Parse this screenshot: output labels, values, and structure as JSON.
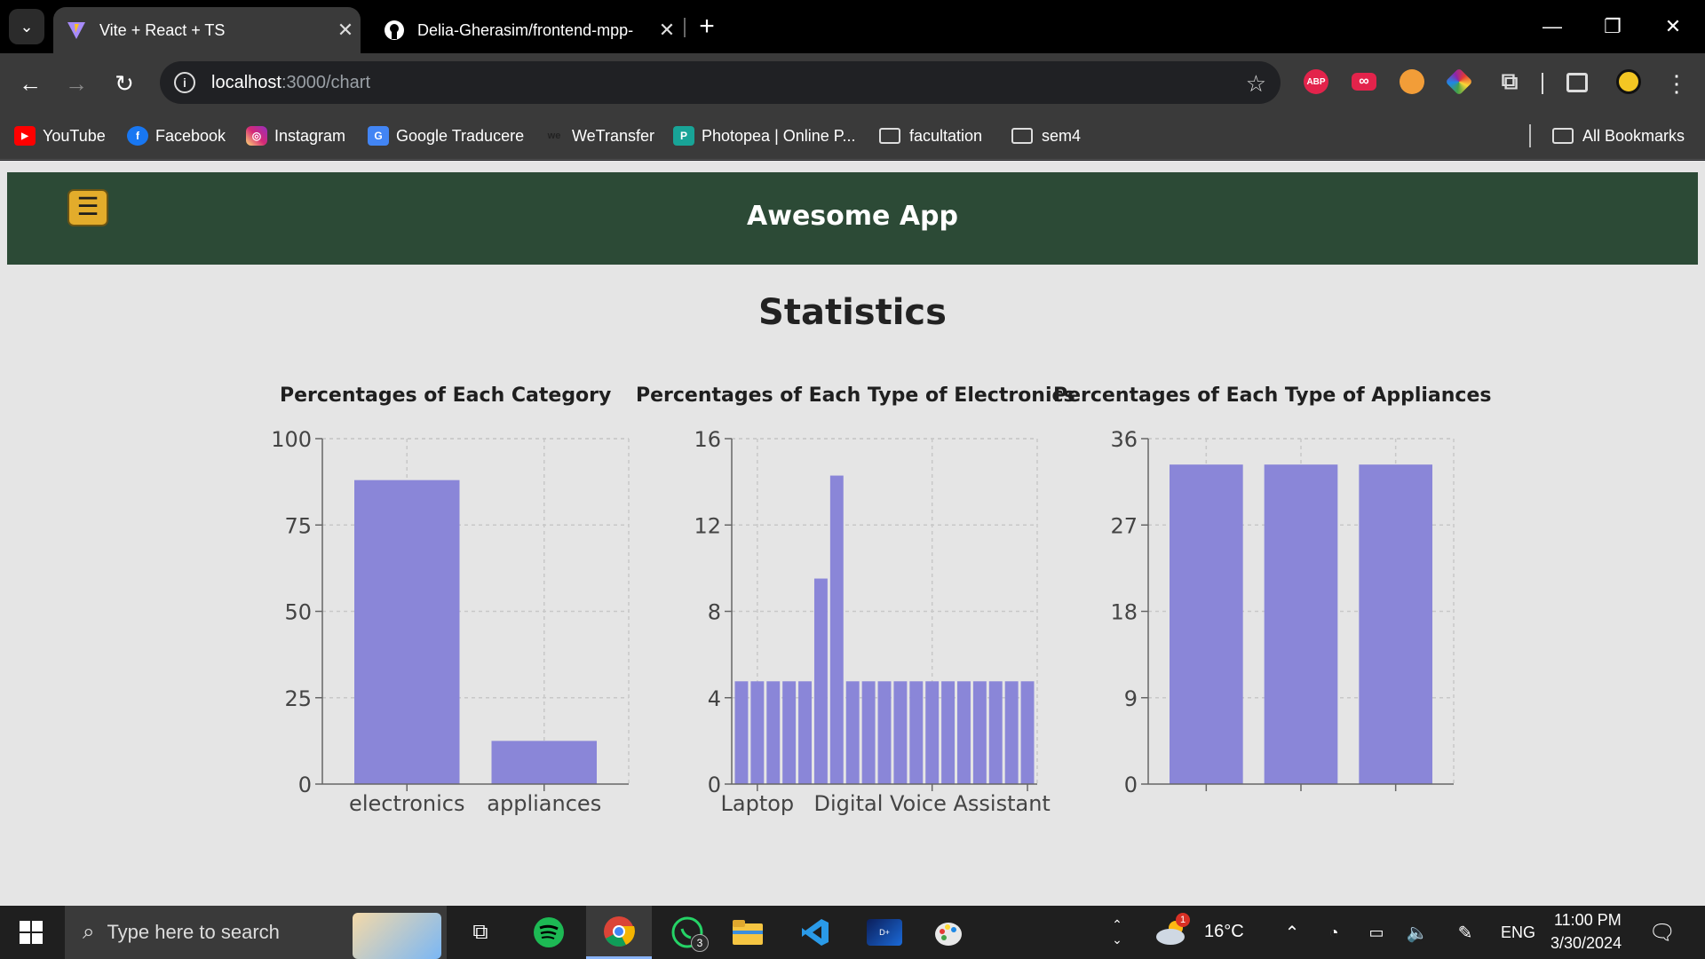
{
  "browser": {
    "tabs": [
      {
        "title": "Vite + React + TS",
        "active": true,
        "icon": "vite-icon"
      },
      {
        "title": "Delia-Gherasim/frontend-mpp-",
        "active": false,
        "icon": "github-icon"
      }
    ],
    "url_host": "localhost",
    "url_path": ":3000/chart",
    "bookmarks": [
      {
        "label": "YouTube",
        "icon": "youtube-icon",
        "color": "#ff0000"
      },
      {
        "label": "Facebook",
        "icon": "facebook-icon",
        "color": "#1877f2"
      },
      {
        "label": "Instagram",
        "icon": "instagram-icon",
        "color": "#d62976"
      },
      {
        "label": "Google Traducere",
        "icon": "google-translate-icon",
        "color": "#4285f4"
      },
      {
        "label": "WeTransfer",
        "icon": "wetransfer-icon",
        "color": "#333333"
      },
      {
        "label": "Photopea | Online P...",
        "icon": "photopea-icon",
        "color": "#18a497"
      },
      {
        "label": "facultation",
        "icon": "folder-icon"
      },
      {
        "label": "sem4",
        "icon": "folder-icon"
      }
    ],
    "all_bookmarks": "All Bookmarks",
    "extensions": [
      {
        "name": "adblock-plus-icon",
        "label": "ABP",
        "color": "#e3234b"
      },
      {
        "name": "infinity-extension-icon",
        "label": "∞",
        "color": "#e3234b"
      },
      {
        "name": "monkey-extension-icon",
        "label": "🐵",
        "color": "#f29d38"
      },
      {
        "name": "color-picker-icon",
        "label": "◆",
        "color": "#7b3fe4"
      }
    ]
  },
  "app": {
    "title": "Awesome App",
    "menu_icon": "hamburger-icon",
    "page_title": "Statistics",
    "accent_color": "#2c4a36",
    "button_color": "#e3ac2b",
    "bar_color": "#8a86d8"
  },
  "chart_data": [
    {
      "type": "bar",
      "title": "Percentages of Each Category",
      "categories": [
        "electronics",
        "appliances"
      ],
      "values": [
        88,
        12.5
      ],
      "ylim": [
        0,
        100
      ],
      "yticks": [
        "0",
        "25",
        "50",
        "75",
        "100"
      ],
      "xticklabels": [
        "electronics",
        "appliances"
      ],
      "grid": true
    },
    {
      "type": "bar",
      "title": "Percentages of Each Type of Electronics",
      "categories": [
        "Laptop",
        "",
        "",
        "",
        "",
        "",
        "",
        "Digital Voice Assistant",
        "",
        "",
        "",
        "",
        "",
        "",
        "",
        "",
        "",
        "",
        ""
      ],
      "values": [
        4.76,
        4.76,
        4.76,
        4.76,
        4.76,
        9.52,
        14.29,
        4.76,
        4.76,
        4.76,
        4.76,
        4.76,
        4.76,
        4.76,
        4.76,
        4.76,
        4.76,
        4.76,
        4.76
      ],
      "ylim": [
        0,
        16
      ],
      "yticks": [
        "0",
        "4",
        "8",
        "12",
        "16"
      ],
      "xticklabels": [
        "Laptop",
        "Digital Voice Assistant"
      ],
      "grid": true
    },
    {
      "type": "bar",
      "title": "Percentages of Each Type of Appliances",
      "categories": [
        "",
        "",
        ""
      ],
      "values": [
        33.3,
        33.3,
        33.3
      ],
      "ylim": [
        0,
        36
      ],
      "yticks": [
        "0",
        "9",
        "18",
        "27",
        "36"
      ],
      "xticklabels": [],
      "grid": true
    }
  ],
  "taskbar": {
    "search_placeholder": "Type here to search",
    "weather": "16°C",
    "language": "ENG",
    "time": "11:00 PM",
    "date": "3/30/2024",
    "whatsapp_badge": "3",
    "weather_badge": "1"
  }
}
